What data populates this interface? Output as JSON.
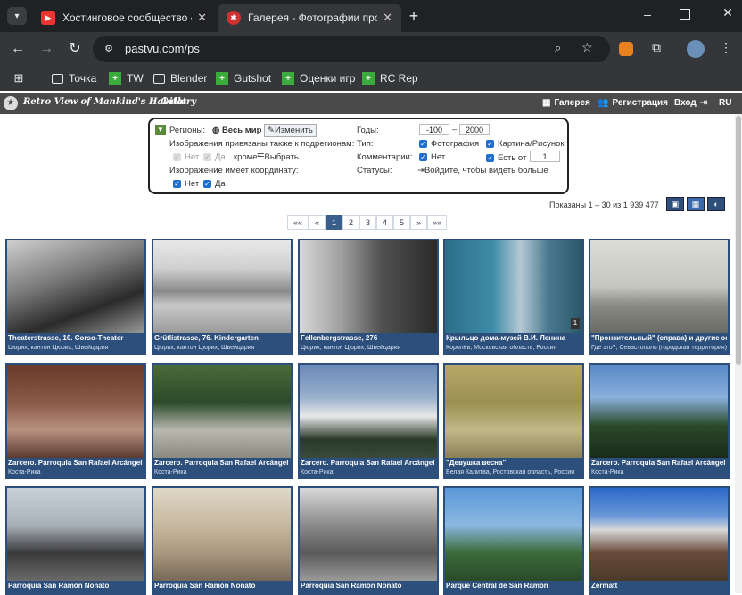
{
  "browser": {
    "tabs": [
      {
        "title": "Хостинговое сообщество «Tim",
        "active": false
      },
      {
        "title": "Галерея - Фотографии прошло",
        "active": true
      }
    ],
    "new_tab": "+",
    "url": "pastvu.com/ps",
    "bookmarks": [
      "Точка",
      "TW",
      "Blender",
      "Gutshot",
      "Оценки игр",
      "RC Rep"
    ]
  },
  "site": {
    "logo_text": "Retro View of Mankind's Habitat",
    "section": "Gallery",
    "nav": [
      "Галерея",
      "Регистрация",
      "Вход",
      "RU"
    ]
  },
  "filter": {
    "regions_label": "Регионы:",
    "regions_value": "Весь мир",
    "change_button": "Изменить",
    "subregions_label": "Изображения привязаны также к подрегионам:",
    "no_label": "Нет",
    "yes_label": "Да",
    "except_label": "кроме:",
    "choose_label": "Выбрать",
    "coords_label": "Изображение имеет координату:",
    "coords_no": "Нет",
    "coords_yes": "Да",
    "years_label": "Годы:",
    "year_from": "-100",
    "year_dash": "–",
    "year_to": "2000",
    "type_label": "Тип:",
    "type_photo": "Фотография",
    "type_picture": "Картина/Рисунок",
    "comments_label": "Комментарии:",
    "comments_no": "Нет",
    "comments_from": "Есть от",
    "comments_from_value": "1",
    "statuses_label": "Статусы:",
    "statuses_value": "Войдите, чтобы видеть больше"
  },
  "results": {
    "shown": "Показаны 1 – 30 из 1 939 477"
  },
  "pager": [
    "««",
    "«",
    "1",
    "2",
    "3",
    "4",
    "5",
    "»",
    "»»"
  ],
  "photos": [
    {
      "title": "Theaterstrasse, 10. Corso-Theater",
      "place": "Цюрих, кантон Цюрих, Швейцария"
    },
    {
      "title": "Grütlistrasse, 76. Kindergarten",
      "place": "Цюрих, кантон Цюрих, Швейцария"
    },
    {
      "title": "Fellenbergstrasse, 276",
      "place": "Цюрих, кантон Цюрих, Швейцария"
    },
    {
      "title": "Крыльцо дома-музей В.И. Ленина",
      "place": "Королёв, Московская область, Россия"
    },
    {
      "title": "\"Пронзительный\" (справа) и другие эсмин...",
      "place": "Где это?, Севастополь (городская территория), ..."
    },
    {
      "title": "Zarcero. Parroquia San Rafael Arcángel",
      "place": "Коста-Рика"
    },
    {
      "title": "Zarcero. Parroquia San Rafael Arcángel",
      "place": "Коста-Рика"
    },
    {
      "title": "Zarcero. Parroquia San Rafael Arcángel",
      "place": "Коста-Рика"
    },
    {
      "title": "\"Девушка весна\"",
      "place": "Белая Калитва, Ростовская область, Россия"
    },
    {
      "title": "Zarcero. Parroquia San Rafael Arcángel",
      "place": "Коста-Рика"
    },
    {
      "title": "Parroquia San Ramón Nonato",
      "place": ""
    },
    {
      "title": "Parroquia San Ramón Nonato",
      "place": ""
    },
    {
      "title": "Parroquia San Ramón Nonato",
      "place": ""
    },
    {
      "title": "Parque Central de San Ramón",
      "place": ""
    },
    {
      "title": "Zermatt",
      "place": ""
    }
  ],
  "photo_badge": "1"
}
